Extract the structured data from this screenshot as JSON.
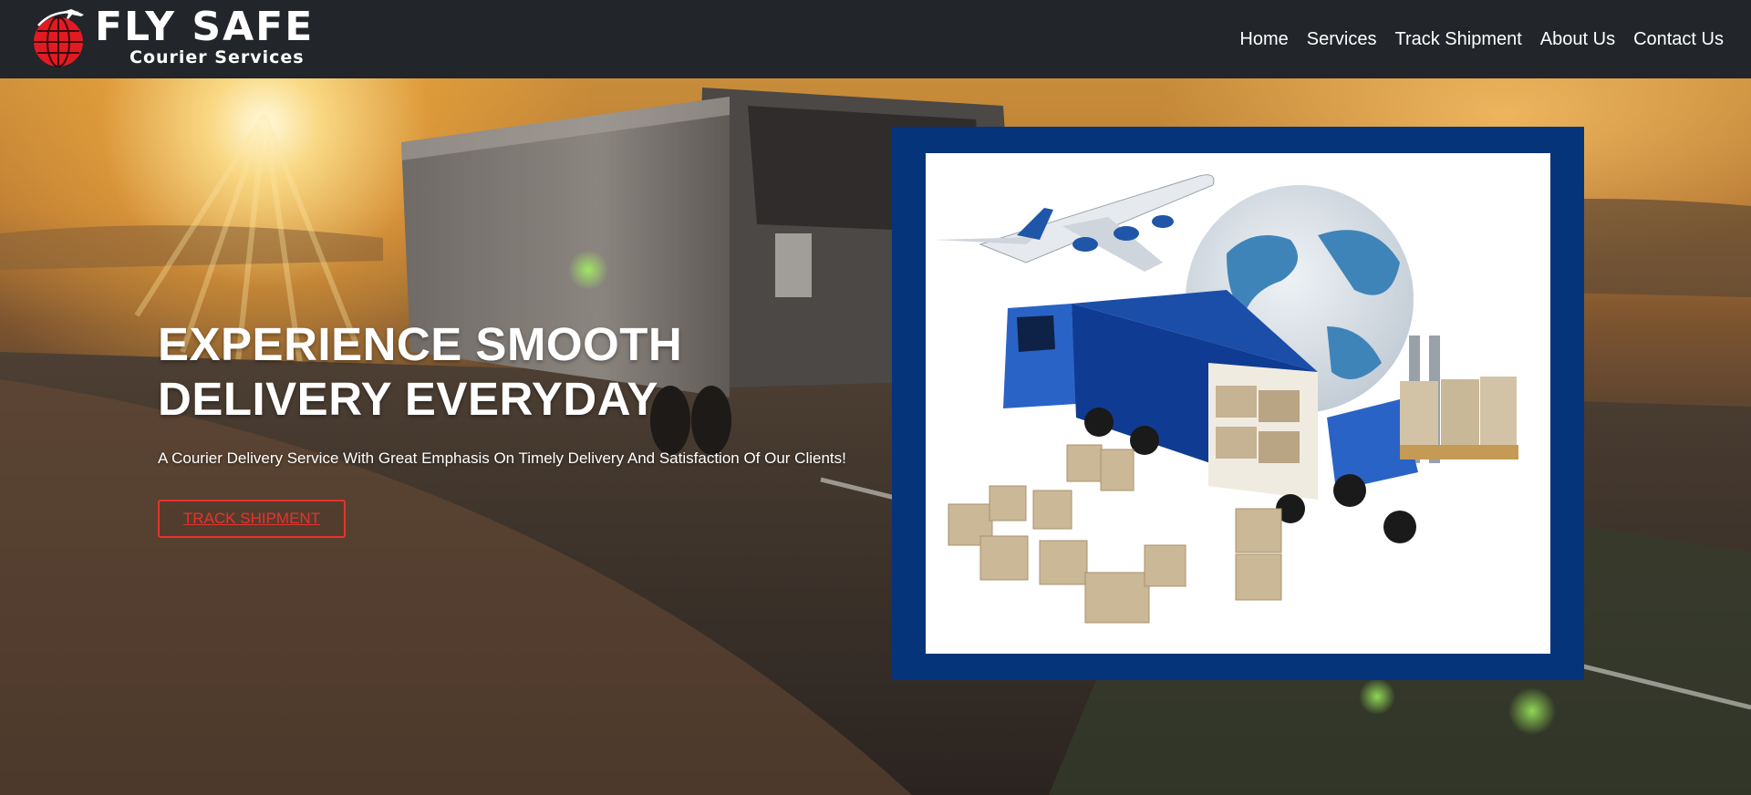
{
  "brand": {
    "name": "FLY SAFE",
    "tagline": "Courier Services",
    "logo_icon": "globe-airplane-icon",
    "colors": {
      "globe": "#e21b23",
      "text": "#ffffff",
      "navbar": "#222529"
    }
  },
  "nav": {
    "items": [
      {
        "label": "Home"
      },
      {
        "label": "Services"
      },
      {
        "label": "Track Shipment"
      },
      {
        "label": "About Us"
      },
      {
        "label": "Contact Us"
      }
    ]
  },
  "hero": {
    "title_line1": "EXPERIENCE SMOOTH",
    "title_line2": "DELIVERY EVERYDAY",
    "subtitle": "A Courier Delivery Service With Great Emphasis On Timely Delivery And Satisfaction Of Our Clients!",
    "cta_label": "TRACK SHIPMENT",
    "background_image": "truck-on-highway-at-sunset",
    "feature_image": "airplane-globe-truck-forklift-boxes",
    "colors": {
      "cta": "#e8322e",
      "frame": "#06347b"
    }
  }
}
